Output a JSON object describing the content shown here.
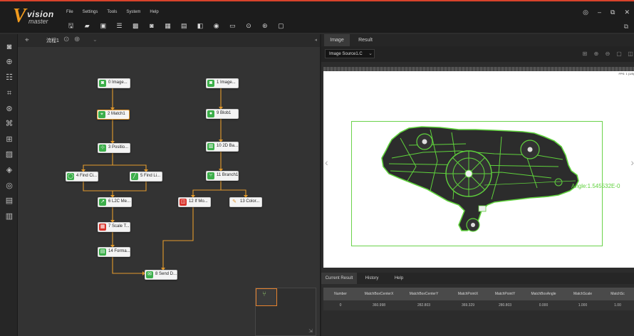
{
  "app": {
    "logo_main": "vision",
    "logo_sub": "master"
  },
  "menu": [
    "File",
    "Settings",
    "Tools",
    "System",
    "Help"
  ],
  "toolbar_icons": [
    "save-icon",
    "open-icon",
    "save-as-icon",
    "list-icon",
    "image-icon",
    "camera-icon",
    "grid-icon",
    "display-icon",
    "layout-icon",
    "global-icon",
    "monitor-icon",
    "run-once-icon",
    "run-loop-icon",
    "stop-icon"
  ],
  "window_controls": [
    "◎",
    "–",
    "⧉",
    "✕"
  ],
  "canvas": {
    "process_tab": "流程1"
  },
  "nodes": [
    {
      "id": "n0",
      "label": "0 Image...",
      "icon": "image-source-icon",
      "status": "ok"
    },
    {
      "id": "n2",
      "label": "2 Match1",
      "icon": "match-icon",
      "status": "ok",
      "selected": true
    },
    {
      "id": "n3",
      "label": "3 Positio...",
      "icon": "position-icon",
      "status": "ok"
    },
    {
      "id": "n4",
      "label": "4 Find Ci...",
      "icon": "find-circle-icon",
      "status": "ok"
    },
    {
      "id": "n5",
      "label": "5 Find Li...",
      "icon": "find-line-icon",
      "status": "ok"
    },
    {
      "id": "n6",
      "label": "6 L2C Me...",
      "icon": "measure-icon",
      "status": "ok"
    },
    {
      "id": "n7",
      "label": "7 Scale T...",
      "icon": "scale-icon",
      "status": "error"
    },
    {
      "id": "n14",
      "label": "14 Forma...",
      "icon": "format-icon",
      "status": "ok"
    },
    {
      "id": "n8",
      "label": "8 Send D...",
      "icon": "send-data-icon",
      "status": "ok"
    },
    {
      "id": "n1",
      "label": "1 Image...",
      "icon": "image-source-icon",
      "status": "ok"
    },
    {
      "id": "n9",
      "label": "9 Blob1",
      "icon": "blob-icon",
      "status": "ok"
    },
    {
      "id": "n10",
      "label": "10 2D Ba...",
      "icon": "barcode-icon",
      "status": "ok"
    },
    {
      "id": "n11",
      "label": "11 Branch1",
      "icon": "branch-icon",
      "status": "ok"
    },
    {
      "id": "n12",
      "label": "12 If Mo...",
      "icon": "if-module-icon",
      "status": "error"
    },
    {
      "id": "n13",
      "label": "13 Color...",
      "icon": "color-icon",
      "status": "ok"
    }
  ],
  "right_panel": {
    "tabs": [
      "Image",
      "Result"
    ],
    "active_tab": "Image",
    "image_source": "Image Source1.C",
    "angle_text": "Angle:1.545532E-0",
    "status_strip": "FPS: 1 (1/8)",
    "bottom_tabs": [
      "Current Result",
      "History",
      "Help"
    ],
    "active_bottom_tab": "Current Result"
  },
  "result_table": {
    "columns": [
      "Number",
      "MatchBoxCenterX",
      "MatchBoxCenterY",
      "MatchPointX",
      "MatchPointY",
      "MatchBoxAngle",
      "MatchScale",
      "MatchSc"
    ],
    "rows": [
      [
        "0",
        "360.998",
        "282.803",
        "369.329",
        "280.803",
        "0.000",
        "1.000",
        "1.00"
      ]
    ]
  },
  "colors": {
    "accent": "#e89a2c",
    "node_ok": "#3cae4a",
    "node_error": "#d9332b",
    "match_overlay": "#5fd23c",
    "brand_red": "#d9432b"
  }
}
